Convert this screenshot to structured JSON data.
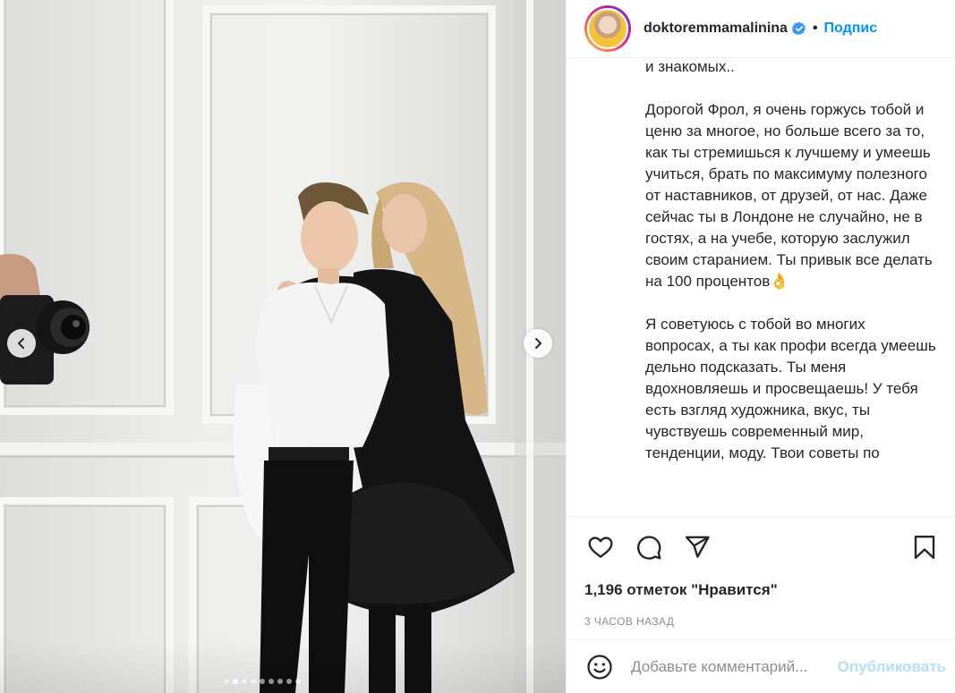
{
  "header": {
    "username": "doktoremmamalinina",
    "separator": "•",
    "follow_label": "Подпис"
  },
  "caption": {
    "paragraphs": [
      "и знакомых..",
      "Дорогой Фрол, я очень горжусь тобой и ценю за многое, но больше всего за то, как ты стремишься к лучшему и умеешь учиться, брать по максимуму полезного от наставников, от друзей, от нас. Даже сейчас ты в Лондоне не случайно, не в гостях, а на учебе, которую заслужил своим старанием. Ты привык все делать на 100 процентов👌",
      "Я советуюсь с тобой во многих вопросах, а ты как профи всегда умеешь дельно подсказать. Ты меня вдохновляешь и просвещаешь! У тебя есть взгляд художника, вкус, ты чувствуешь современный мир, тенденции, моду. Твои советы по"
    ]
  },
  "likes_label": "1,196 отметок \"Нравится\"",
  "timestamp": "3 ЧАСОВ НАЗАД",
  "comment": {
    "placeholder": "Добавьте комментарий...",
    "publish_label": "Опубликовать"
  },
  "carousel": {
    "total_slides": 9,
    "active_slide": 2
  },
  "colors": {
    "accent": "#0095f6",
    "publish_disabled": "#b2dffc",
    "muted": "#8e8e8e"
  },
  "icons": {
    "like": "heart-icon",
    "comment": "comment-icon",
    "share": "paper-plane-icon",
    "save": "bookmark-icon",
    "emoji": "smiley-icon",
    "prev": "chevron-left-icon",
    "next": "chevron-right-icon",
    "verified": "verified-badge-icon"
  }
}
